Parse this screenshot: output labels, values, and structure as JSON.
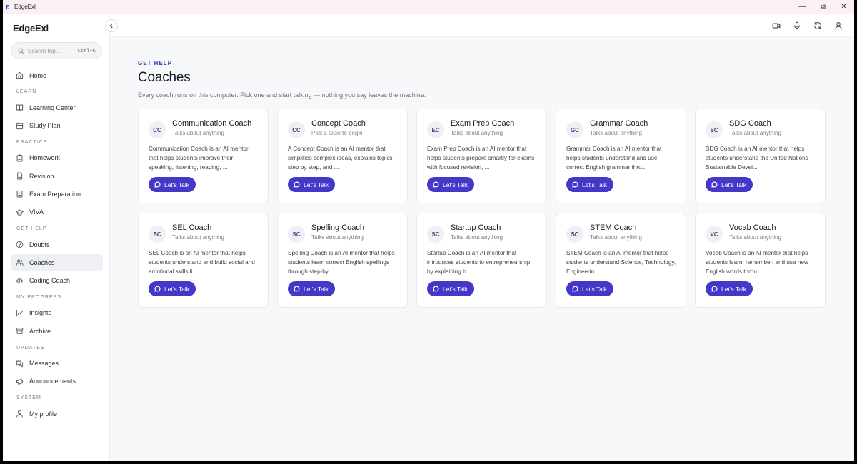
{
  "window": {
    "title": "EdgeExl"
  },
  "sidebar": {
    "brand": "EdgeExl",
    "search": {
      "placeholder": "Search topi...",
      "shortcut": "Ctrl+K"
    },
    "home": {
      "label": "Home",
      "icon": "home-icon"
    },
    "sections": [
      {
        "title": "LEARN",
        "items": [
          {
            "label": "Learning Center",
            "icon": "book-icon"
          },
          {
            "label": "Study Plan",
            "icon": "calendar-icon"
          }
        ]
      },
      {
        "title": "PRACTICE",
        "items": [
          {
            "label": "Homework",
            "icon": "clipboard-icon"
          },
          {
            "label": "Revision",
            "icon": "file-icon"
          },
          {
            "label": "Exam Preparation",
            "icon": "checklist-icon"
          },
          {
            "label": "VIVA",
            "icon": "graduation-cap-icon"
          }
        ]
      },
      {
        "title": "GET HELP",
        "items": [
          {
            "label": "Doubts",
            "icon": "help-circle-icon"
          },
          {
            "label": "Coaches",
            "icon": "users-icon",
            "active": true
          },
          {
            "label": "Coding Coach",
            "icon": "code-icon"
          }
        ]
      },
      {
        "title": "MY PROGRESS",
        "items": [
          {
            "label": "Insights",
            "icon": "chart-line-icon"
          },
          {
            "label": "Archive",
            "icon": "archive-icon"
          }
        ]
      },
      {
        "title": "UPDATES",
        "items": [
          {
            "label": "Messages",
            "icon": "messages-icon"
          },
          {
            "label": "Announcements",
            "icon": "megaphone-icon"
          }
        ]
      },
      {
        "title": "SYSTEM",
        "items": [
          {
            "label": "My profile",
            "icon": "user-icon"
          }
        ]
      }
    ]
  },
  "topbar": {
    "icons": [
      "video-icon",
      "mic-icon",
      "refresh-icon",
      "user-icon"
    ]
  },
  "main": {
    "eyebrow": "GET HELP",
    "title": "Coaches",
    "description": "Every coach runs on this computer. Pick one and start talking — nothing you say leaves the machine.",
    "button_label": "Let's Talk",
    "coaches": [
      {
        "initials": "CC",
        "name": "Communication Coach",
        "subtitle": "Talks about anything",
        "desc": "Communication Coach is an AI mentor that helps students improve their speaking, listening, reading, ..."
      },
      {
        "initials": "CC",
        "name": "Concept Coach",
        "subtitle": "Pick a topic to begin",
        "desc": "A Concept Coach is an AI mentor that simplifies complex ideas, explains topics step by step, and ..."
      },
      {
        "initials": "EC",
        "name": "Exam Prep Coach",
        "subtitle": "Talks about anything",
        "desc": "Exam Prep Coach is an AI mentor that helps students prepare smartly for exams with focused revision, ..."
      },
      {
        "initials": "GC",
        "name": "Grammar Coach",
        "subtitle": "Talks about anything",
        "desc": "Grammar Coach is an AI mentor that helps students understand and use correct English grammar thro..."
      },
      {
        "initials": "SC",
        "name": "SDG Coach",
        "subtitle": "Talks about anything",
        "desc": "SDG Coach is an AI mentor that helps students understand the United Nations Sustainable Devel..."
      },
      {
        "initials": "SC",
        "name": "SEL Coach",
        "subtitle": "Talks about anything",
        "desc": "SEL Coach is an AI mentor that helps students understand and build social and emotional skills li..."
      },
      {
        "initials": "SC",
        "name": "Spelling Coach",
        "subtitle": "Talks about anything",
        "desc": "Spelling Coach is an AI mentor that helps students learn correct English spellings through step-by..."
      },
      {
        "initials": "SC",
        "name": "Startup Coach",
        "subtitle": "Talks about anything",
        "desc": "Startup Coach is an AI mentor that introduces students to entrepreneurship by explaining b..."
      },
      {
        "initials": "SC",
        "name": "STEM Coach",
        "subtitle": "Talks about anything",
        "desc": "STEM Coach is an AI mentor that helps students understand Science, Technology, Engineerin..."
      },
      {
        "initials": "VC",
        "name": "Vocab Coach",
        "subtitle": "Talks about anything",
        "desc": "Vocab Coach is an AI mentor that helps students learn, remember, and use new English words throu..."
      }
    ]
  },
  "colors": {
    "accent": "#4538c9",
    "active_nav": "#eef0f5"
  }
}
